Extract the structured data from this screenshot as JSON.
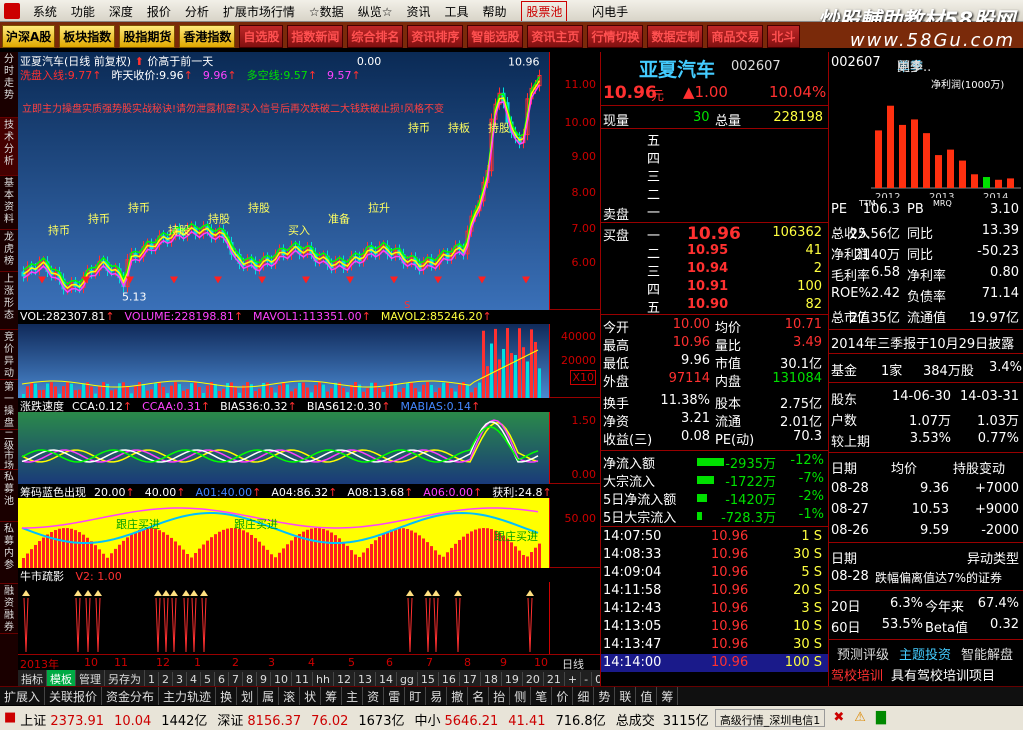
{
  "menu": {
    "items": [
      "系统",
      "功能",
      "深度",
      "报价",
      "分析",
      "扩展市场行情",
      "☆数据",
      "纵览☆",
      "资讯",
      "工具",
      "帮助"
    ],
    "stock_pool": "股票池",
    "right_label": "闪电手"
  },
  "watermark": {
    "line1": "炒股輔助教材58股网",
    "line2": "www.58Gu.com"
  },
  "toolbar": {
    "buttons": [
      "沪深A股",
      "板块指数",
      "股指期货",
      "香港指数"
    ],
    "dark_buttons": [
      "自选股",
      "指数新闻",
      "综合排名",
      "资讯排序",
      "智能选股",
      "资讯主页",
      "行情切换",
      "数据定制",
      "商品交易",
      "北斗"
    ]
  },
  "sidetabs": [
    "分时走势",
    "技术分析",
    "基本资料",
    "龙虎榜",
    "上涨形态",
    "竞价异动",
    "第一操盘",
    "二级市场",
    "私募池",
    "私募内参",
    "融资融券"
  ],
  "main_chart": {
    "title": "亚夏汽车(日线 前复权)",
    "price_note": "价高于前一天",
    "ma_label": "0.00",
    "line2": [
      {
        "t": "洗盘入线:",
        "v": "9.77",
        "c": "#ff3030"
      },
      {
        "t": "昨天收价:",
        "v": "9.96",
        "c": "#fff"
      },
      {
        "t": "",
        "v": "9.96",
        "c": "#f4f"
      },
      {
        "t": "多空线:",
        "v": "9.57",
        "c": "#00e000"
      },
      {
        "t": "",
        "v": "9.57",
        "c": "#f4f"
      }
    ],
    "scroll_text": "立即主力操盘实质强势股实战秘诀!请勿泄露机密!买入信号后再次跌破二大钱跌破止损!风格不变",
    "y_ticks": [
      "11.00",
      "10.00",
      "9.00",
      "8.00",
      "7.00",
      "6.00"
    ],
    "annotations": [
      "持币",
      "持币",
      "持币",
      "持股",
      "持股",
      "持股",
      "买入",
      "准备",
      "拉升",
      "持币",
      "持板",
      "持股"
    ],
    "low_label": "5.13",
    "high_label": "10.96",
    "marker_s": "S"
  },
  "vol_pane": {
    "fields": [
      {
        "t": "VOL:",
        "v": "282307.81",
        "c": "#fff"
      },
      {
        "t": "VOLUME:",
        "v": "228198.81",
        "c": "#f4f"
      },
      {
        "t": "MAVOL1:",
        "v": "113351.00",
        "c": "#f4f"
      },
      {
        "t": "MAVOL2:",
        "v": "85246.20",
        "c": "#ffff40"
      }
    ],
    "y_ticks": [
      "40000",
      "20000"
    ],
    "unit": "X10"
  },
  "speed_pane": {
    "title": "涨跌速度",
    "fields": [
      {
        "t": "CCA:",
        "v": "0.12",
        "c": "#fff"
      },
      {
        "t": "CCAA:",
        "v": "0.31",
        "c": "#f4f"
      },
      {
        "t": "BIAS36:",
        "v": "0.32",
        "c": "#fff"
      },
      {
        "t": "BIAS612:",
        "v": "0.30",
        "c": "#fff"
      },
      {
        "t": "MABIAS:",
        "v": "0.14",
        "c": "#48f"
      }
    ],
    "y_ticks": [
      "1.50",
      "0.00"
    ]
  },
  "chip_pane": {
    "title": "筹码蓝色出现",
    "fields": [
      {
        "t": "",
        "v": "20.00",
        "c": "#fff"
      },
      {
        "t": "",
        "v": "40.00",
        "c": "#fff"
      },
      {
        "t": "A01:",
        "v": "40.00",
        "c": "#48f"
      },
      {
        "t": "A04:",
        "v": "86.32",
        "c": "#fff"
      },
      {
        "t": "A08:",
        "v": "13.68",
        "c": "#fff"
      },
      {
        "t": "A06:",
        "v": "0.00",
        "c": "#f4f"
      },
      {
        "t": "获利:",
        "v": "24.8",
        "c": "#fff"
      }
    ],
    "labels": [
      "跟庄买进",
      "跟庄买进",
      "跟庄买进"
    ],
    "y_ticks": [
      "50.00"
    ]
  },
  "fan_pane": {
    "title": "牛市疏影",
    "field": "V2: 1.00"
  },
  "xaxis": {
    "labels": [
      "2013年",
      "10",
      "11",
      "12",
      "1",
      "2",
      "3",
      "4",
      "5",
      "6",
      "7",
      "8",
      "9",
      "10"
    ],
    "right": "日线"
  },
  "bottomtabs": [
    "指标",
    "模板",
    "管理",
    "另存为",
    "1",
    "2",
    "3",
    "4",
    "5",
    "6",
    "7",
    "8",
    "9",
    "10",
    "11",
    "hh",
    "12",
    "13",
    "14",
    "gg",
    "15",
    "16",
    "17",
    "18",
    "19",
    "20",
    "21",
    "+",
    "-",
    "0"
  ],
  "quote": {
    "name": "亚夏汽车",
    "code": "002607",
    "price": "10.96",
    "unit": "元",
    "change": "▲1.00",
    "pct": "10.04%",
    "now_vol_label": "现量",
    "now_vol": "30",
    "total_label": "总量",
    "total": "228198",
    "sell_labels": [
      "五",
      "四",
      "三",
      "二",
      "一"
    ],
    "sell_side": "卖盘",
    "buy_side": "买盘",
    "buy": [
      {
        "n": "一",
        "p": "10.96",
        "v": "106362"
      },
      {
        "n": "二",
        "p": "10.95",
        "v": "41"
      },
      {
        "n": "三",
        "p": "10.94",
        "v": "2"
      },
      {
        "n": "四",
        "p": "10.91",
        "v": "100"
      },
      {
        "n": "五",
        "p": "10.90",
        "v": "82"
      }
    ],
    "stats": [
      [
        {
          "l": "今开",
          "v": "10.00",
          "c": "red"
        },
        {
          "l": "均价",
          "v": "10.71",
          "c": "red"
        }
      ],
      [
        {
          "l": "最高",
          "v": "10.96",
          "c": "red"
        },
        {
          "l": "量比",
          "v": "3.49",
          "c": "red"
        }
      ],
      [
        {
          "l": "最低",
          "v": "9.96",
          "c": "wht"
        },
        {
          "l": "市值",
          "v": "30.1亿",
          "c": "wht"
        }
      ],
      [
        {
          "l": "外盘",
          "v": "97114",
          "c": "red"
        },
        {
          "l": "内盘",
          "v": "131084",
          "c": "grn"
        }
      ],
      [
        {
          "l": "换手",
          "v": "11.38%",
          "c": "wht"
        },
        {
          "l": "股本",
          "v": "2.75亿",
          "c": "wht"
        }
      ],
      [
        {
          "l": "净资",
          "v": "3.21",
          "c": "wht"
        },
        {
          "l": "流通",
          "v": "2.01亿",
          "c": "wht"
        }
      ],
      [
        {
          "l": "收益(三)",
          "v": "0.08",
          "c": "wht"
        },
        {
          "l": "PE(动)",
          "v": "70.3",
          "c": "wht"
        }
      ]
    ],
    "flows": [
      {
        "l": "净流入额",
        "v": "-2935万",
        "p": "-12%",
        "bar": 0.8
      },
      {
        "l": "大宗流入",
        "v": "-1722万",
        "p": "-7%",
        "bar": 0.5
      },
      {
        "l": "5日净流入额",
        "v": "-1420万",
        "p": "-2%",
        "bar": 0.3
      },
      {
        "l": "5日大宗流入",
        "v": "-728.3万",
        "p": "-1%",
        "bar": 0.15
      }
    ],
    "ticks": [
      [
        "14:07:50",
        "10.96",
        "1 S"
      ],
      [
        "14:08:33",
        "10.96",
        "30 S"
      ],
      [
        "14:09:04",
        "10.96",
        "5 S"
      ],
      [
        "14:11:58",
        "10.96",
        "20 S"
      ],
      [
        "14:12:43",
        "10.96",
        "3 S"
      ],
      [
        "14:13:05",
        "10.96",
        "10 S"
      ],
      [
        "14:13:47",
        "10.96",
        "30 S"
      ],
      [
        "14:14:00",
        "10.96",
        "100 S"
      ]
    ]
  },
  "right": {
    "code": "002607",
    "tabs": [
      "单季",
      "同李",
      "更多.."
    ],
    "chart_title": "净利润(1000万)",
    "chart_data": {
      "type": "bar",
      "categories": [
        "2012",
        "2013",
        "2014"
      ],
      "series": [
        {
          "name": "净利润",
          "values": [
            2.1,
            3.0,
            2.3,
            2.5,
            2.0,
            1.2,
            1.4,
            1.0,
            0.5,
            0.4,
            0.3,
            0.35
          ]
        }
      ],
      "colors": [
        "#ff3010",
        "#ff3010",
        "#ff3010",
        "#ff3010",
        "#ff3010",
        "#ff3010",
        "#ff3010",
        "#ff3010",
        "#ff3010",
        "#00e000",
        "#ff3010",
        "#ff3010"
      ],
      "ylim": [
        0,
        3.5
      ]
    },
    "fin": [
      [
        "PE",
        "TTM",
        "106.3",
        "PB",
        "MRQ",
        "3.10"
      ],
      [
        "总收入",
        "",
        "25.56亿",
        "同比",
        "",
        "13.39"
      ],
      [
        "净利润",
        "",
        "2140万",
        "同比",
        "",
        "-50.23"
      ],
      [
        "毛利率",
        "",
        "6.58",
        "净利率",
        "",
        "0.80"
      ],
      [
        "ROE%",
        "",
        "2.42",
        "负债率",
        "",
        "71.14"
      ],
      [
        "总市值",
        "",
        "27.35亿",
        "流通值",
        "",
        "19.97亿"
      ]
    ],
    "report": "2014年三季报于10月29日披露",
    "fund": [
      "基金",
      "1家",
      "384万股",
      "3.4%"
    ],
    "holders": [
      [
        "股东",
        "14-06-30",
        "14-03-31"
      ],
      [
        "户数",
        "1.07万",
        "1.03万"
      ],
      [
        "较上期",
        "3.53%",
        "0.77%"
      ]
    ],
    "holder_head": [
      "日期",
      "均价",
      "持股变动"
    ],
    "holder_rows": [
      [
        "08-28",
        "9.36",
        "+7000"
      ],
      [
        "08-27",
        "10.53",
        "+9000"
      ],
      [
        "08-26",
        "9.59",
        "-2000"
      ]
    ],
    "abn_head": [
      "日期",
      "异动类型"
    ],
    "abn_row": [
      "08-28",
      "跌幅偏离值达7%的证券"
    ],
    "perf": [
      [
        "20日",
        "6.3%",
        "今年来",
        "67.4%"
      ],
      [
        "60日",
        "53.5%",
        "Beta值",
        "0.32"
      ]
    ],
    "links": [
      "预测评级",
      "主题投资",
      "智能解盘"
    ],
    "news": [
      [
        "驾校培训",
        "具有驾校培训项目"
      ],
      [
        "汽车金融",
        "公司是安徽省最大的"
      ]
    ]
  },
  "funcrow": [
    "扩展入",
    "关联报价",
    "资金分布",
    "主力轨迹",
    "换",
    "划",
    "属",
    "滚",
    "状",
    "筹",
    "主",
    "资",
    "雷",
    "盯",
    "易",
    "撤",
    "名",
    "抬",
    "侧",
    "笔",
    "价",
    "细",
    "势",
    "联",
    "值",
    "筹"
  ],
  "status": [
    {
      "n": "上证",
      "p": "2373.91",
      "c": "10.04",
      "a": "1442亿"
    },
    {
      "n": "深证",
      "p": "8156.37",
      "c": "76.02",
      "a": "1673亿"
    },
    {
      "n": "中小",
      "p": "5646.21",
      "c": "41.41",
      "a": "716.8亿"
    }
  ],
  "status_total": {
    "l": "总成交",
    "v": "3115亿"
  },
  "status_info": "高级行情_深圳电信1"
}
